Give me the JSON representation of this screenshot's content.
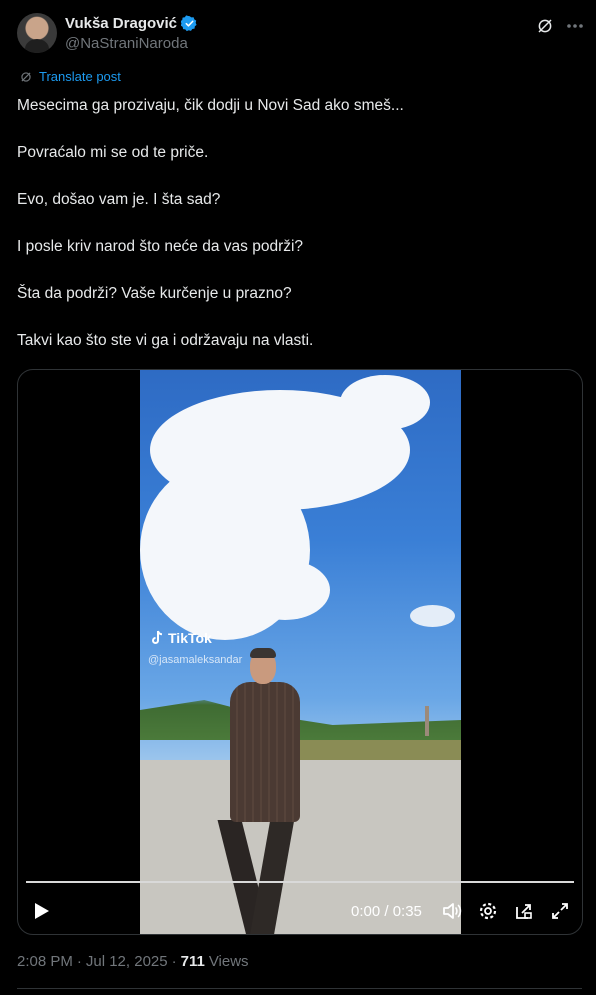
{
  "author": {
    "display_name": "Vukša Dragović",
    "handle": "@NaStraniNaroda",
    "verified": true
  },
  "translate_label": "Translate post",
  "tweet_lines": [
    "Mesecima ga prozivaju, čik dodji u Novi Sad ako smeš...",
    "Povraćalo mi se od te priče.",
    "Evo, došao vam je. I šta sad?",
    "I posle kriv narod što neće da vas podrži?",
    "Šta da podrži? Vaše kurčenje u prazno?",
    "Takvi kao što ste vi ga i održavaju na vlasti."
  ],
  "video": {
    "watermark": "TikTok",
    "watermark_handle": "@jasamaleksandar",
    "time_display": "0:00 / 0:35",
    "progress": 0
  },
  "meta": {
    "time": "2:08 PM",
    "date": "Jul 12, 2025",
    "separator": "·",
    "views_count": "711",
    "views_label": "Views"
  },
  "colors": {
    "background": "#000000",
    "text": "#e7e9ea",
    "secondary": "#71767b",
    "accent": "#1d9bf0"
  },
  "icons": [
    "verified-icon",
    "grok-icon",
    "more-icon",
    "translate-icon",
    "tiktok-icon",
    "play-icon",
    "volume-icon",
    "settings-icon",
    "pip-icon",
    "fullscreen-icon"
  ]
}
